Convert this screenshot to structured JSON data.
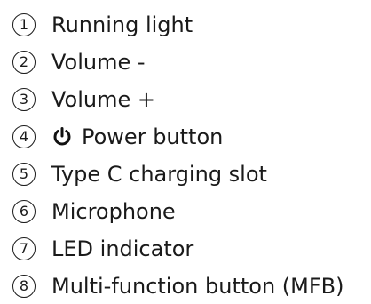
{
  "items": [
    {
      "number": "1",
      "label": "Running light"
    },
    {
      "number": "2",
      "label": "Volume -"
    },
    {
      "number": "3",
      "label": "Volume +"
    },
    {
      "number": "4",
      "label": "Power button",
      "icon": "power-icon"
    },
    {
      "number": "5",
      "label": "Type C charging slot"
    },
    {
      "number": "6",
      "label": "Microphone"
    },
    {
      "number": "7",
      "label": "LED indicator"
    },
    {
      "number": "8",
      "label": "Multi-function button (MFB)"
    }
  ]
}
